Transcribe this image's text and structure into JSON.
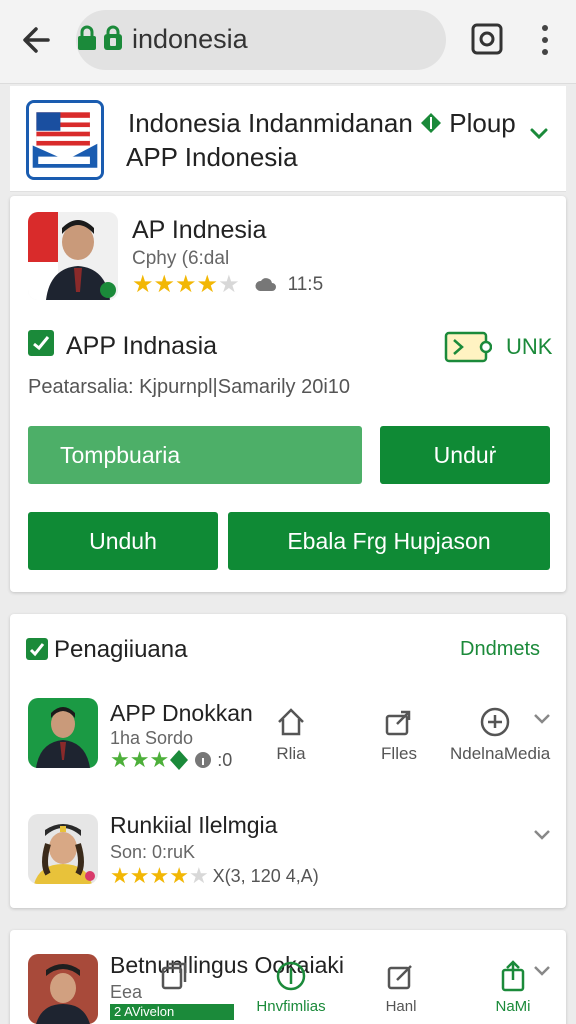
{
  "browser": {
    "url": "indonesia"
  },
  "header": {
    "title": "Indonesia Indanmidanan",
    "title_suffix": "Ploup",
    "subtitle": "APP Indonesia"
  },
  "app": {
    "name": "AP Indnesia",
    "developer": "Cphy (6:dal",
    "rating": 3.5,
    "rating_count": "11:5",
    "checked_title": "APP Indnasia",
    "unk_label": "UNK",
    "description": "Peatarsalia: Kjpurnpl|Samarily 20i10",
    "buttons": {
      "primary_light": "Tompbuaria",
      "unduh_right": "Unduṙ",
      "unduh_left": "Unduh",
      "wide": "Ebala Frg Hupjason"
    }
  },
  "list": {
    "title": "Penagiiuana",
    "more": "Dndmets",
    "items": [
      {
        "name": "APP Dnokkan",
        "sub": "1ha Sordo",
        "rating": 3,
        "rating_extra": ":0",
        "actions": [
          {
            "label": "Rlia",
            "icon": "home-icon"
          },
          {
            "label": "Flles",
            "icon": "share-icon"
          },
          {
            "label": "NdelnaMedia",
            "icon": "download-icon"
          }
        ]
      },
      {
        "name": "Runkiial Ilelmgia",
        "sub": "Son: 0:ruK",
        "rating": 4,
        "rating_extra": "X(3, 120 4,A)"
      }
    ]
  },
  "bottom": {
    "name": "Betnunllingus Ookaiaki",
    "sub": "Eea",
    "badge": "2 AVivelon",
    "actions": [
      {
        "label": "",
        "icon": "copy-icon"
      },
      {
        "label": "Hnvfimlias",
        "icon": "plus-circle-icon"
      },
      {
        "label": "Hanl",
        "icon": "edit-icon"
      },
      {
        "label": "NaMi",
        "icon": "share-icon"
      }
    ]
  },
  "colors": {
    "brand_green": "#0f8a35",
    "light_green": "#4daf68",
    "star": "#f2b705"
  }
}
